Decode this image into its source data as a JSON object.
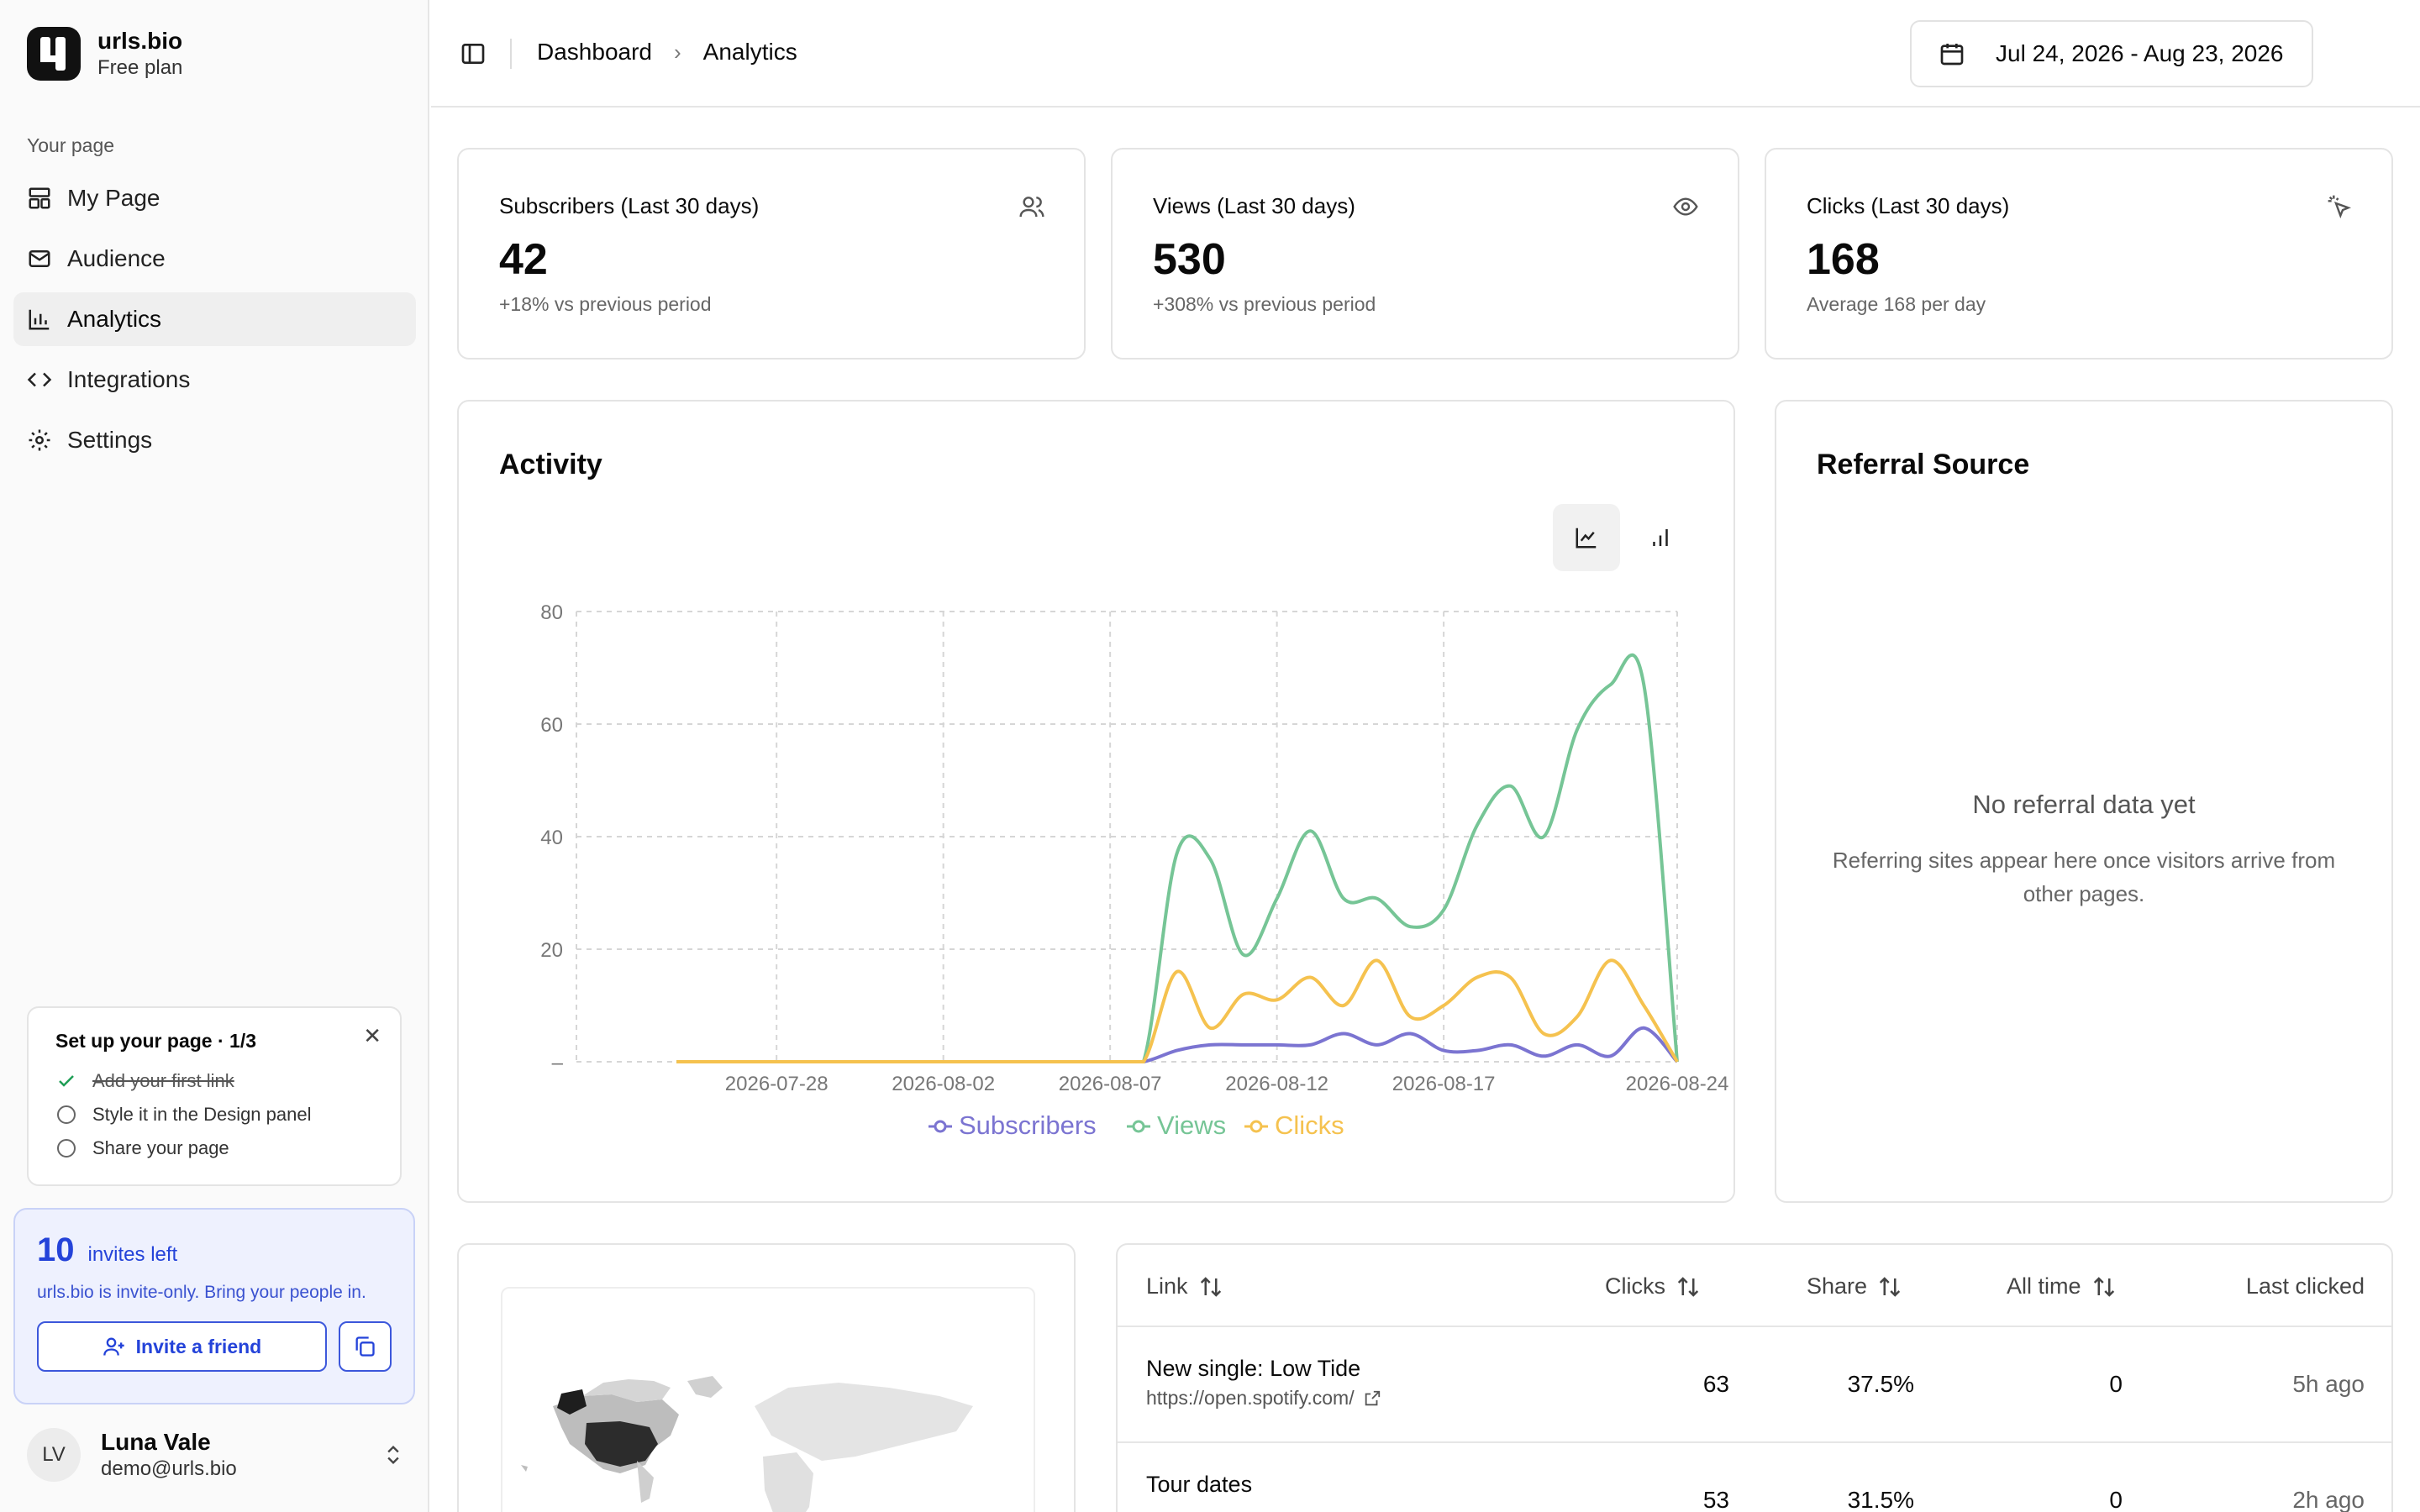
{
  "brand": {
    "name": "urls.bio",
    "plan": "Free plan"
  },
  "sidebar": {
    "section_label": "Your page",
    "items": [
      {
        "label": "My Page",
        "icon": "layout-icon"
      },
      {
        "label": "Audience",
        "icon": "mail-icon"
      },
      {
        "label": "Analytics",
        "icon": "bar-chart-icon",
        "active": true
      },
      {
        "label": "Integrations",
        "icon": "code-icon"
      },
      {
        "label": "Settings",
        "icon": "gear-icon"
      }
    ]
  },
  "setup": {
    "title": "Set up your page · 1/3",
    "steps": [
      {
        "label": "Add your first link",
        "done": true
      },
      {
        "label": "Style it in the Design panel",
        "done": false
      },
      {
        "label": "Share your page",
        "done": false
      }
    ]
  },
  "invite": {
    "count": "10",
    "left_label": "invites left",
    "description": "urls.bio is invite-only. Bring your people in.",
    "button_label": "Invite a friend"
  },
  "user": {
    "initials": "LV",
    "name": "Luna Vale",
    "email": "demo@urls.bio"
  },
  "header": {
    "breadcrumb": [
      "Dashboard",
      "Analytics"
    ],
    "date_range": "Jul 24, 2026 - Aug 23, 2026"
  },
  "stats": [
    {
      "title": "Subscribers (Last 30 days)",
      "value": "42",
      "sub": "+18% vs previous period",
      "icon": "users-icon"
    },
    {
      "title": "Views (Last 30 days)",
      "value": "530",
      "sub": "+308% vs previous period",
      "icon": "eye-icon"
    },
    {
      "title": "Clicks (Last 30 days)",
      "value": "168",
      "sub": "Average 168 per day",
      "icon": "pointer-click-icon"
    }
  ],
  "activity": {
    "title": "Activity"
  },
  "referral": {
    "title": "Referral Source",
    "empty_title": "No referral data yet",
    "empty_desc": "Referring sites appear here once visitors arrive from other pages."
  },
  "links_table": {
    "columns": [
      "Link",
      "Clicks",
      "Share",
      "All time",
      "Last clicked"
    ],
    "rows": [
      {
        "title": "New single: Low Tide",
        "url": "https://open.spotify.com/",
        "clicks": "63",
        "share": "37.5%",
        "all_time": "0",
        "last": "5h ago"
      },
      {
        "title": "Tour dates",
        "url": "",
        "clicks": "53",
        "share": "31.5%",
        "all_time": "0",
        "last": "2h ago"
      }
    ]
  },
  "colors": {
    "subscribers": "#7b74d1",
    "views": "#76c596",
    "clicks": "#f5c24f",
    "accent": "#2443d9"
  },
  "chart_data": {
    "type": "line",
    "x_ticks": [
      "2026-07-28",
      "2026-08-02",
      "2026-08-07",
      "2026-08-12",
      "2026-08-17",
      "2026-08-24"
    ],
    "y_ticks": [
      0,
      20,
      40,
      60,
      80
    ],
    "ylim": [
      0,
      80
    ],
    "legend_position": "bottom",
    "grid": true,
    "x": [
      "2026-07-25",
      "2026-07-26",
      "2026-07-27",
      "2026-07-28",
      "2026-07-29",
      "2026-07-30",
      "2026-07-31",
      "2026-08-01",
      "2026-08-02",
      "2026-08-03",
      "2026-08-04",
      "2026-08-05",
      "2026-08-06",
      "2026-08-07",
      "2026-08-08",
      "2026-08-09",
      "2026-08-10",
      "2026-08-11",
      "2026-08-12",
      "2026-08-13",
      "2026-08-14",
      "2026-08-15",
      "2026-08-16",
      "2026-08-17",
      "2026-08-18",
      "2026-08-19",
      "2026-08-20",
      "2026-08-21",
      "2026-08-22",
      "2026-08-23",
      "2026-08-24"
    ],
    "series": [
      {
        "name": "Subscribers",
        "values": [
          0,
          0,
          0,
          0,
          0,
          0,
          0,
          0,
          0,
          0,
          0,
          0,
          0,
          0,
          0,
          2,
          3,
          3,
          3,
          3,
          5,
          3,
          5,
          2,
          2,
          3,
          1,
          3,
          1,
          6,
          0
        ]
      },
      {
        "name": "Views",
        "values": [
          0,
          0,
          0,
          0,
          0,
          0,
          0,
          0,
          0,
          0,
          0,
          0,
          0,
          0,
          0,
          37,
          36,
          19,
          29,
          41,
          29,
          29,
          24,
          27,
          42,
          49,
          40,
          59,
          67,
          67,
          0
        ]
      },
      {
        "name": "Clicks",
        "values": [
          0,
          0,
          0,
          0,
          0,
          0,
          0,
          0,
          0,
          0,
          0,
          0,
          0,
          0,
          0,
          16,
          6,
          12,
          11,
          15,
          10,
          18,
          8,
          10,
          15,
          15,
          5,
          8,
          18,
          10,
          0
        ]
      }
    ]
  }
}
